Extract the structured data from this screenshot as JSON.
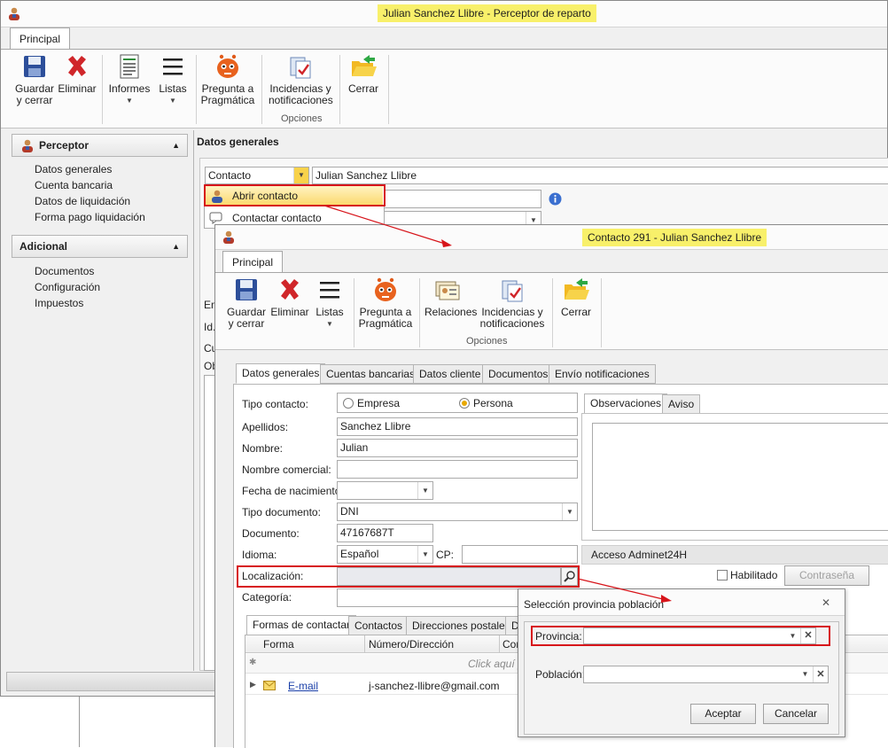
{
  "win1": {
    "title": "Julian Sanchez Llibre - Perceptor de reparto",
    "ribbon_tab": "Principal",
    "ribbon": {
      "guardar": "Guardar\ny cerrar",
      "eliminar": "Eliminar",
      "informes": "Informes",
      "listas": "Listas",
      "pregunta": "Pregunta a\nPragmática",
      "incidencias": "Incidencias y\nnotificaciones",
      "cerrar": "Cerrar",
      "group_opciones": "Opciones"
    },
    "sidebar": {
      "section1": "Perceptor",
      "items1": [
        "Datos generales",
        "Cuenta bancaria",
        "Datos de liquidación",
        "Forma pago liquidación"
      ],
      "section2": "Adicional",
      "items2": [
        "Documentos",
        "Configuración",
        "Impuestos"
      ]
    },
    "main_title": "Datos generales",
    "contacto_dropdown": "Contacto",
    "contacto_value": "Julian Sanchez Llibre",
    "menu": {
      "abrir": "Abrir contacto",
      "contactar": "Contactar contacto"
    },
    "partial_labels": [
      "Em",
      "Id.",
      "Cu",
      "Ob"
    ]
  },
  "win2": {
    "title": "Contacto 291 - Julian Sanchez Llibre",
    "ribbon_tab": "Principal",
    "ribbon": {
      "guardar": "Guardar\ny cerrar",
      "eliminar": "Eliminar",
      "listas": "Listas",
      "pregunta": "Pregunta a\nPragmática",
      "relaciones": "Relaciones",
      "incidencias": "Incidencias y\nnotificaciones",
      "cerrar": "Cerrar",
      "group_opciones": "Opciones"
    },
    "tabs": [
      "Datos generales",
      "Cuentas bancarias",
      "Datos cliente",
      "Documentos",
      "Envío notificaciones"
    ],
    "form": {
      "tipo_contacto_label": "Tipo contacto:",
      "opt_empresa": "Empresa",
      "opt_persona": "Persona",
      "apellidos_label": "Apellidos:",
      "apellidos_value": "Sanchez Llibre",
      "nombre_label": "Nombre:",
      "nombre_value": "Julian",
      "nombre_comercial_label": "Nombre comercial:",
      "nombre_comercial_value": "",
      "fecha_label": "Fecha de nacimiento:",
      "fecha_value": "",
      "tipo_doc_label": "Tipo documento:",
      "tipo_doc_value": "DNI",
      "documento_label": "Documento:",
      "documento_value": "47167687T",
      "idioma_label": "Idioma:",
      "idioma_value": "Español",
      "cp_label": "CP:",
      "cp_value": "",
      "localizacion_label": "Localización:",
      "localizacion_value": "",
      "categoria_label": "Categoría:"
    },
    "obs_tabs": [
      "Observaciones",
      "Aviso"
    ],
    "acceso_title": "Acceso Adminet24H",
    "habilitado": "Habilitado",
    "contrasena": "Contraseña",
    "bottom_tabs": [
      "Formas de contactar",
      "Contactos",
      "Direcciones postales",
      "D"
    ],
    "grid": {
      "columns": [
        "Forma",
        "Número/Dirección",
        "Con"
      ],
      "new_row": "Click aquí pa",
      "rows": [
        {
          "forma": "E-mail",
          "direccion": "j-sanchez-llibre@gmail.com"
        }
      ]
    }
  },
  "dialog": {
    "title": "Selección provincia población",
    "provincia_label": "Provincia:",
    "provincia_value": "",
    "poblacion_label": "Población:",
    "poblacion_value": "",
    "aceptar": "Aceptar",
    "cancelar": "Cancelar"
  }
}
